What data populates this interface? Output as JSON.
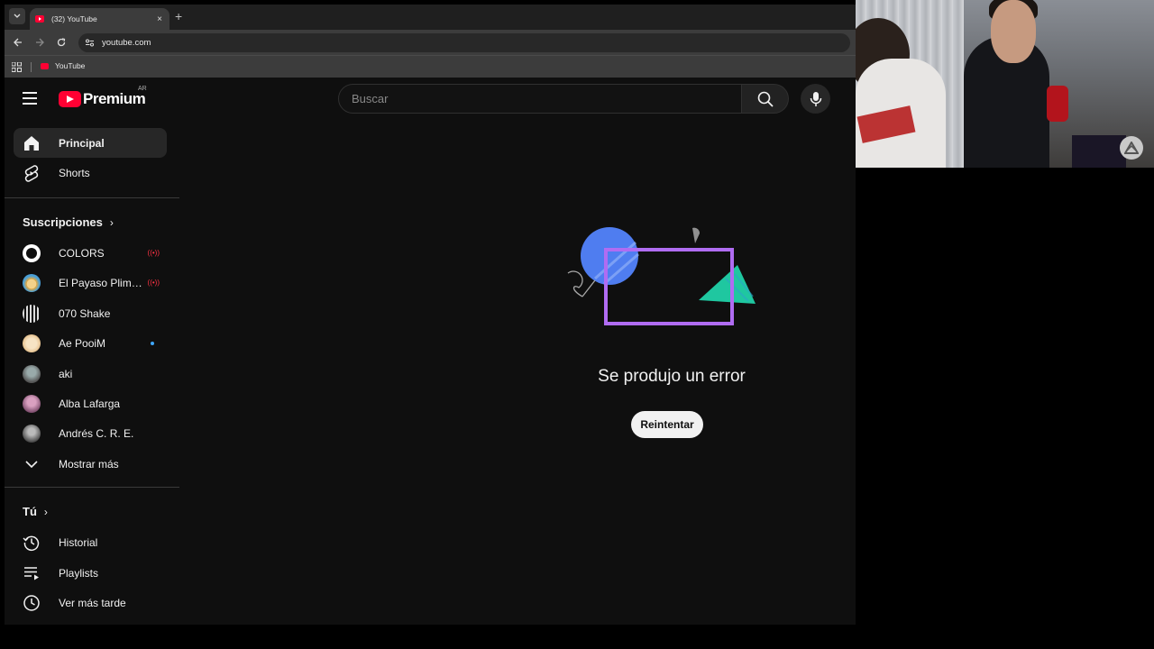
{
  "browser": {
    "tab_title": "(32) YouTube",
    "tab_close": "×",
    "new_tab": "+",
    "url": "youtube.com",
    "bookmark_label": "YouTube"
  },
  "masthead": {
    "logo_text": "Premium",
    "region": "AR",
    "search_placeholder": "Buscar"
  },
  "sidebar": {
    "main": [
      {
        "label": "Principal",
        "icon": "home-icon",
        "active": true
      },
      {
        "label": "Shorts",
        "icon": "shorts-icon"
      }
    ],
    "subscriptions_title": "Suscripciones",
    "subscriptions": [
      {
        "label": "COLORS",
        "badge": "live"
      },
      {
        "label": "El Payaso Plim Plim",
        "badge": "live"
      },
      {
        "label": "070 Shake"
      },
      {
        "label": "Ae PooiM",
        "badge": "new"
      },
      {
        "label": "aki"
      },
      {
        "label": "Alba Lafarga"
      },
      {
        "label": "Andrés C. R. E."
      }
    ],
    "show_more": "Mostrar más",
    "you_title": "Tú",
    "you_items": [
      {
        "label": "Historial",
        "icon": "history-icon"
      },
      {
        "label": "Playlists",
        "icon": "playlists-icon"
      },
      {
        "label": "Ver más tarde",
        "icon": "watch-later-icon"
      }
    ]
  },
  "error": {
    "message": "Se produjo un error",
    "retry_label": "Reintentar"
  },
  "colors": {
    "brand_red": "#ff0033",
    "background": "#0f0f0f",
    "illus_blue": "#4f7df0",
    "illus_purple": "#b06cf2",
    "illus_teal": "#1fc7a0"
  }
}
